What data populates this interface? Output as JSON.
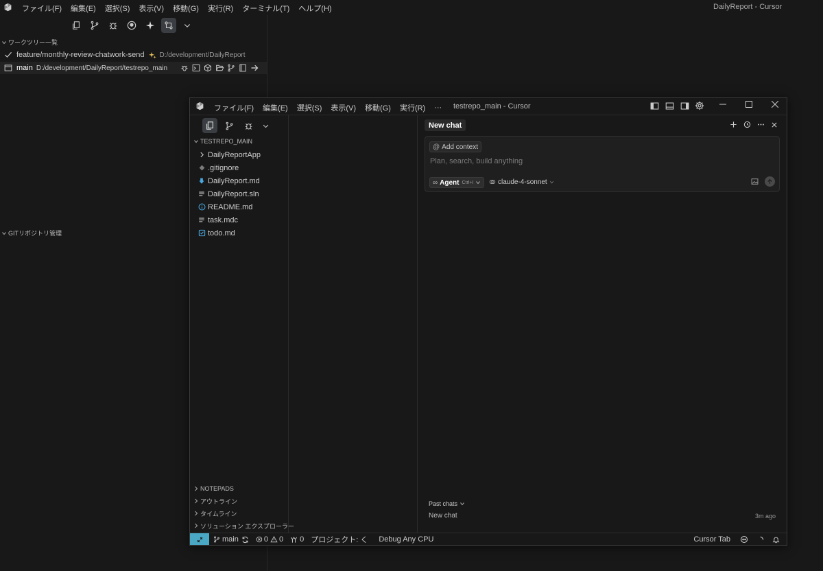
{
  "main_window": {
    "title": "DailyReport - Cursor",
    "menu": [
      "ファイル(F)",
      "編集(E)",
      "選択(S)",
      "表示(V)",
      "移動(G)",
      "実行(R)",
      "ターミナル(T)",
      "ヘルプ(H)"
    ]
  },
  "worktree": {
    "section_title": "ワークツリー一覧",
    "items": [
      {
        "name": "feature/monthly-review-chatwork-send",
        "path": "D:/development/DailyReport"
      },
      {
        "name": "main",
        "path": "D:/development/DailyReport/testrepo_main"
      }
    ]
  },
  "git_section": {
    "title": "GITリポジトリ管理"
  },
  "inner_window": {
    "title": "testrepo_main - Cursor",
    "menu": [
      "ファイル(F)",
      "編集(E)",
      "選択(S)",
      "表示(V)",
      "移動(G)",
      "実行(R)"
    ],
    "more": "···",
    "explorer": {
      "folder": "TESTREPO_MAIN",
      "files": [
        {
          "name": "DailyReportApp",
          "icon": "chevron-right-icon"
        },
        {
          "name": ".gitignore",
          "icon": "git-diamond-icon"
        },
        {
          "name": "DailyReport.md",
          "icon": "markdown-download-icon"
        },
        {
          "name": "DailyReport.sln",
          "icon": "lines-file-icon"
        },
        {
          "name": "README.md",
          "icon": "info-icon"
        },
        {
          "name": "task.mdc",
          "icon": "lines-file-icon"
        },
        {
          "name": "todo.md",
          "icon": "checkbox-icon"
        }
      ],
      "bottom_sections": [
        "NOTEPADS",
        "アウトライン",
        "タイムライン",
        "ソリューション エクスプローラー"
      ]
    },
    "chat": {
      "tab": "New chat",
      "add_context": "Add context",
      "placeholder": "Plan, search, build anything",
      "mode": "Agent",
      "shortcut": "Ctrl+I",
      "model": "claude-4-sonnet",
      "past_chats_label": "Past chats",
      "past_chats": [
        {
          "title": "New chat",
          "time": "3m ago"
        }
      ]
    },
    "status": {
      "branch": "main",
      "errors": "0",
      "warnings": "0",
      "ports": "0",
      "project": "プロジェクト: く",
      "debug": "Debug Any CPU",
      "cursor_tab": "Cursor Tab"
    },
    "colors": {
      "remote_indicator": "#4aa8c5"
    }
  }
}
